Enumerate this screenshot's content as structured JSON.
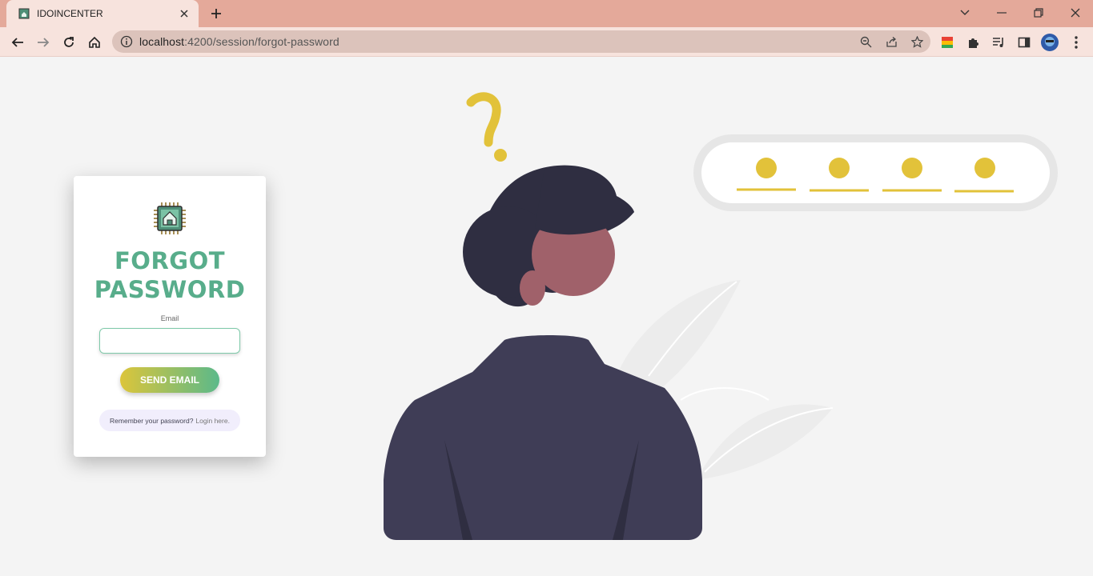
{
  "browser": {
    "tab_title": "IDOINCENTER",
    "url_host": "localhost",
    "url_path": ":4200/session/forgot-password"
  },
  "form": {
    "title": "FORGOT PASSWORD",
    "email_label": "Email",
    "email_value": "",
    "send_button": "SEND EMAIL",
    "remember_text": "Remember your password?",
    "login_text": "Login here."
  },
  "colors": {
    "accent_green": "#58ad8b",
    "accent_yellow": "#dcc53a",
    "illustration_yellow": "#e2c23a",
    "body_dark": "#3f3d56",
    "hair_dark": "#2f2e41",
    "skin": "#a0616a"
  },
  "icons": {
    "tab_favicon": "chip-house-icon",
    "logo": "chip-house-icon"
  }
}
